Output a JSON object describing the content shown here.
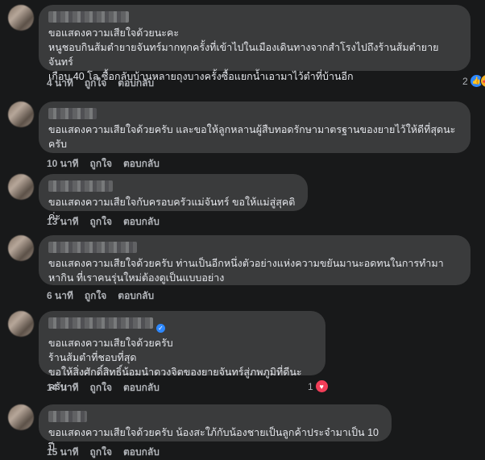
{
  "actions": {
    "like": "ถูกใจ",
    "reply": "ตอบกลับ"
  },
  "comments": [
    {
      "text": "ขอแสดงความเสียใจด้วยนะคะ\nหนูชอบกินส้มตำยายจันทร์มากทุกครั้งที่เข้าไปในเมืองเดินทางจากสำโรงไปถึงร้านส้มตำยายจันทร์\nเกือบ 40 โล ซื้อกลับบ้านหลายถุงบางครั้งซื้อแยกน้ำเอามาไว้ตำที่บ้านอีก",
      "time": "4 นาที",
      "reaction_count": "2"
    },
    {
      "text": "ขอแสดงความเสียใจด้วยครับ และขอให้ลูกหลานผู้สืบทอดรักษามาตรฐานของยายไว้ให้ดีที่สุดนะ\nครับ",
      "time": "10 นาที"
    },
    {
      "text": "ขอแสดงความเสียใจกับครอบครัวแม่จันทร์ ขอให้แม่สู่สุคติค่ะ",
      "time": "13 นาที"
    },
    {
      "text": "ขอแสดงความเสียใจด้วยครับ ท่านเป็นอีกหนึ่งตัวอย่างแห่งความขยันมานะอดทนในการทำมา\nหากิน ที่เราคนรุ่นใหม่ต้องดูเป็นแบบอย่าง",
      "time": "6 นาที"
    },
    {
      "text": "ขอแสดงความเสียใจด้วยครับ\nร้านส้มตำที่ชอบที่สุด\nขอให้สิ่งศักดิ์สิทธิ์น้อมนำดวงจิตของยายจันทร์สู่ภพภูมิที่ดีนะครับ",
      "time": "14 นาที",
      "reaction_count": "1"
    },
    {
      "text": "ขอแสดงความเสียใจด้วยครับ น้องสะใภ้กับน้องชายเป็นลูกค้าประจำมาเป็น 10 ปี",
      "time": "15 นาที"
    }
  ]
}
